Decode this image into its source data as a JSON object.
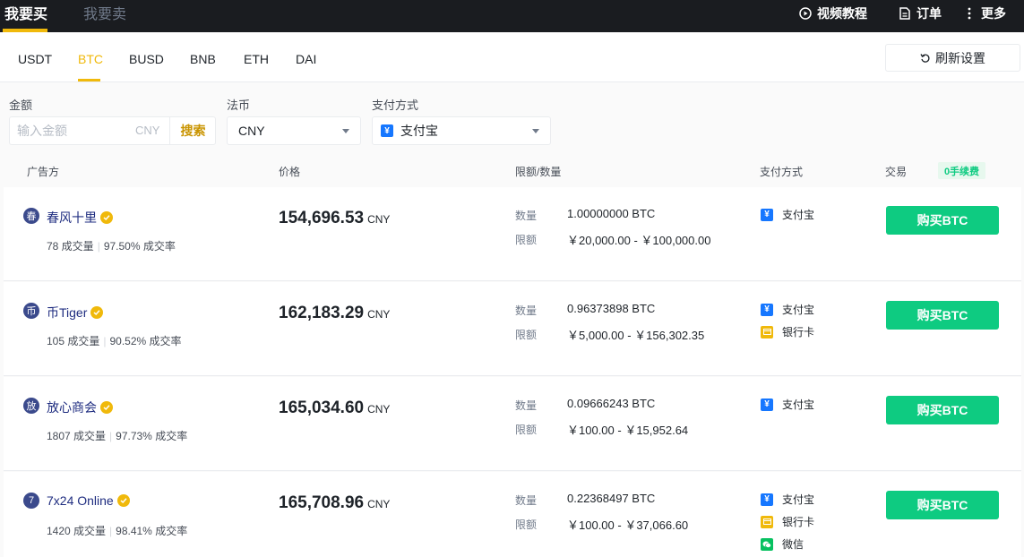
{
  "top": {
    "buy_tab": "我要买",
    "sell_tab": "我要卖",
    "video": "视频教程",
    "orders": "订单",
    "more": "更多"
  },
  "coins": {
    "tabs": [
      "USDT",
      "BTC",
      "BUSD",
      "BNB",
      "ETH",
      "DAI"
    ],
    "active": "BTC",
    "refresh": "刷新设置"
  },
  "filters": {
    "amount_label": "金额",
    "amount_placeholder": "输入金额",
    "amount_currency": "CNY",
    "search": "搜索",
    "fiat_label": "法币",
    "fiat_value": "CNY",
    "payment_label": "支付方式",
    "payment_value": "支付宝"
  },
  "table_header": {
    "advertiser": "广告方",
    "price": "价格",
    "limit": "限额/数量",
    "payment": "支付方式",
    "trade": "交易",
    "fee_badge": "0手续费"
  },
  "row_labels": {
    "quantity": "数量",
    "limit": "限额",
    "buy_button": "购买BTC"
  },
  "ads": [
    {
      "avatar": "春",
      "name": "春风十里",
      "trades": "78 成交量",
      "rate": "97.50% 成交率",
      "price": "154,696.53",
      "currency": "CNY",
      "quantity": "1.00000000 BTC",
      "limit": "￥20,000.00 - ￥100,000.00",
      "payments": [
        "支付宝"
      ]
    },
    {
      "avatar": "币",
      "name": "币Tiger",
      "trades": "105 成交量",
      "rate": "90.52% 成交率",
      "price": "162,183.29",
      "currency": "CNY",
      "quantity": "0.96373898 BTC",
      "limit": "￥5,000.00 - ￥156,302.35",
      "payments": [
        "支付宝",
        "银行卡"
      ]
    },
    {
      "avatar": "放",
      "name": "放心商会",
      "trades": "1807 成交量",
      "rate": "97.73% 成交率",
      "price": "165,034.60",
      "currency": "CNY",
      "quantity": "0.09666243 BTC",
      "limit": "￥100.00 - ￥15,952.64",
      "payments": [
        "支付宝"
      ]
    },
    {
      "avatar": "7",
      "name": "7x24 Online",
      "trades": "1420 成交量",
      "rate": "98.41% 成交率",
      "price": "165,708.96",
      "currency": "CNY",
      "quantity": "0.22368497 BTC",
      "limit": "￥100.00 - ￥37,066.60",
      "payments": [
        "支付宝",
        "银行卡",
        "微信"
      ]
    }
  ],
  "colors": {
    "accent": "#f0b90b",
    "buy": "#0ecb81",
    "topbar": "#1a1c20"
  }
}
